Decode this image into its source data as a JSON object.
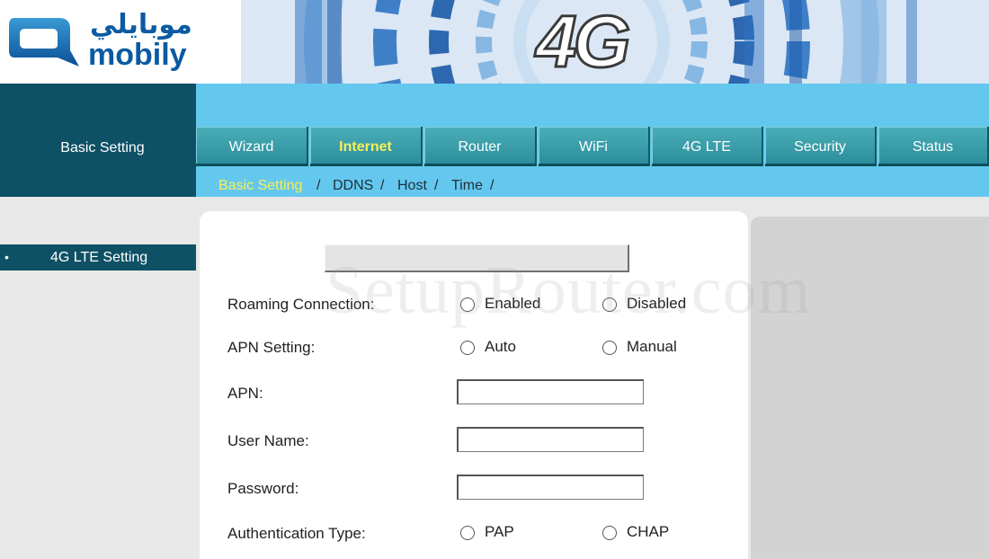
{
  "brand": {
    "arabic_name": "موبايلي",
    "latin_name": "mobily",
    "banner_text": "4G"
  },
  "sidebar": {
    "section_title": "Basic Setting",
    "items": [
      {
        "bullet": "•",
        "label": "4G LTE Setting"
      }
    ]
  },
  "nav": {
    "tabs": [
      {
        "label": "Wizard"
      },
      {
        "label": "Internet",
        "active": true
      },
      {
        "label": "Router"
      },
      {
        "label": "WiFi"
      },
      {
        "label": "4G LTE"
      },
      {
        "label": "Security"
      },
      {
        "label": "Status"
      }
    ],
    "subnav": [
      {
        "label": "Basic Setting",
        "active": true
      },
      {
        "label": "DDNS"
      },
      {
        "label": "Host"
      },
      {
        "label": "Time"
      }
    ],
    "separator": "/"
  },
  "form": {
    "roaming": {
      "label": "Roaming Connection:",
      "options": [
        "Enabled",
        "Disabled"
      ]
    },
    "apn_setting": {
      "label": "APN Setting:",
      "options": [
        "Auto",
        "Manual"
      ]
    },
    "apn": {
      "label": "APN:",
      "value": ""
    },
    "username": {
      "label": "User Name:",
      "value": ""
    },
    "password": {
      "label": "Password:",
      "value": ""
    },
    "auth_type": {
      "label": "Authentication Type:",
      "options": [
        "PAP",
        "CHAP"
      ]
    }
  },
  "watermark": "SetupRouter.com",
  "colors": {
    "nav_bg": "#64c8ee",
    "sidebar_dark": "#0e5165",
    "tab": "#2c8e9a",
    "active_text": "#f6f05a",
    "brand_blue": "#0b5aa2"
  }
}
